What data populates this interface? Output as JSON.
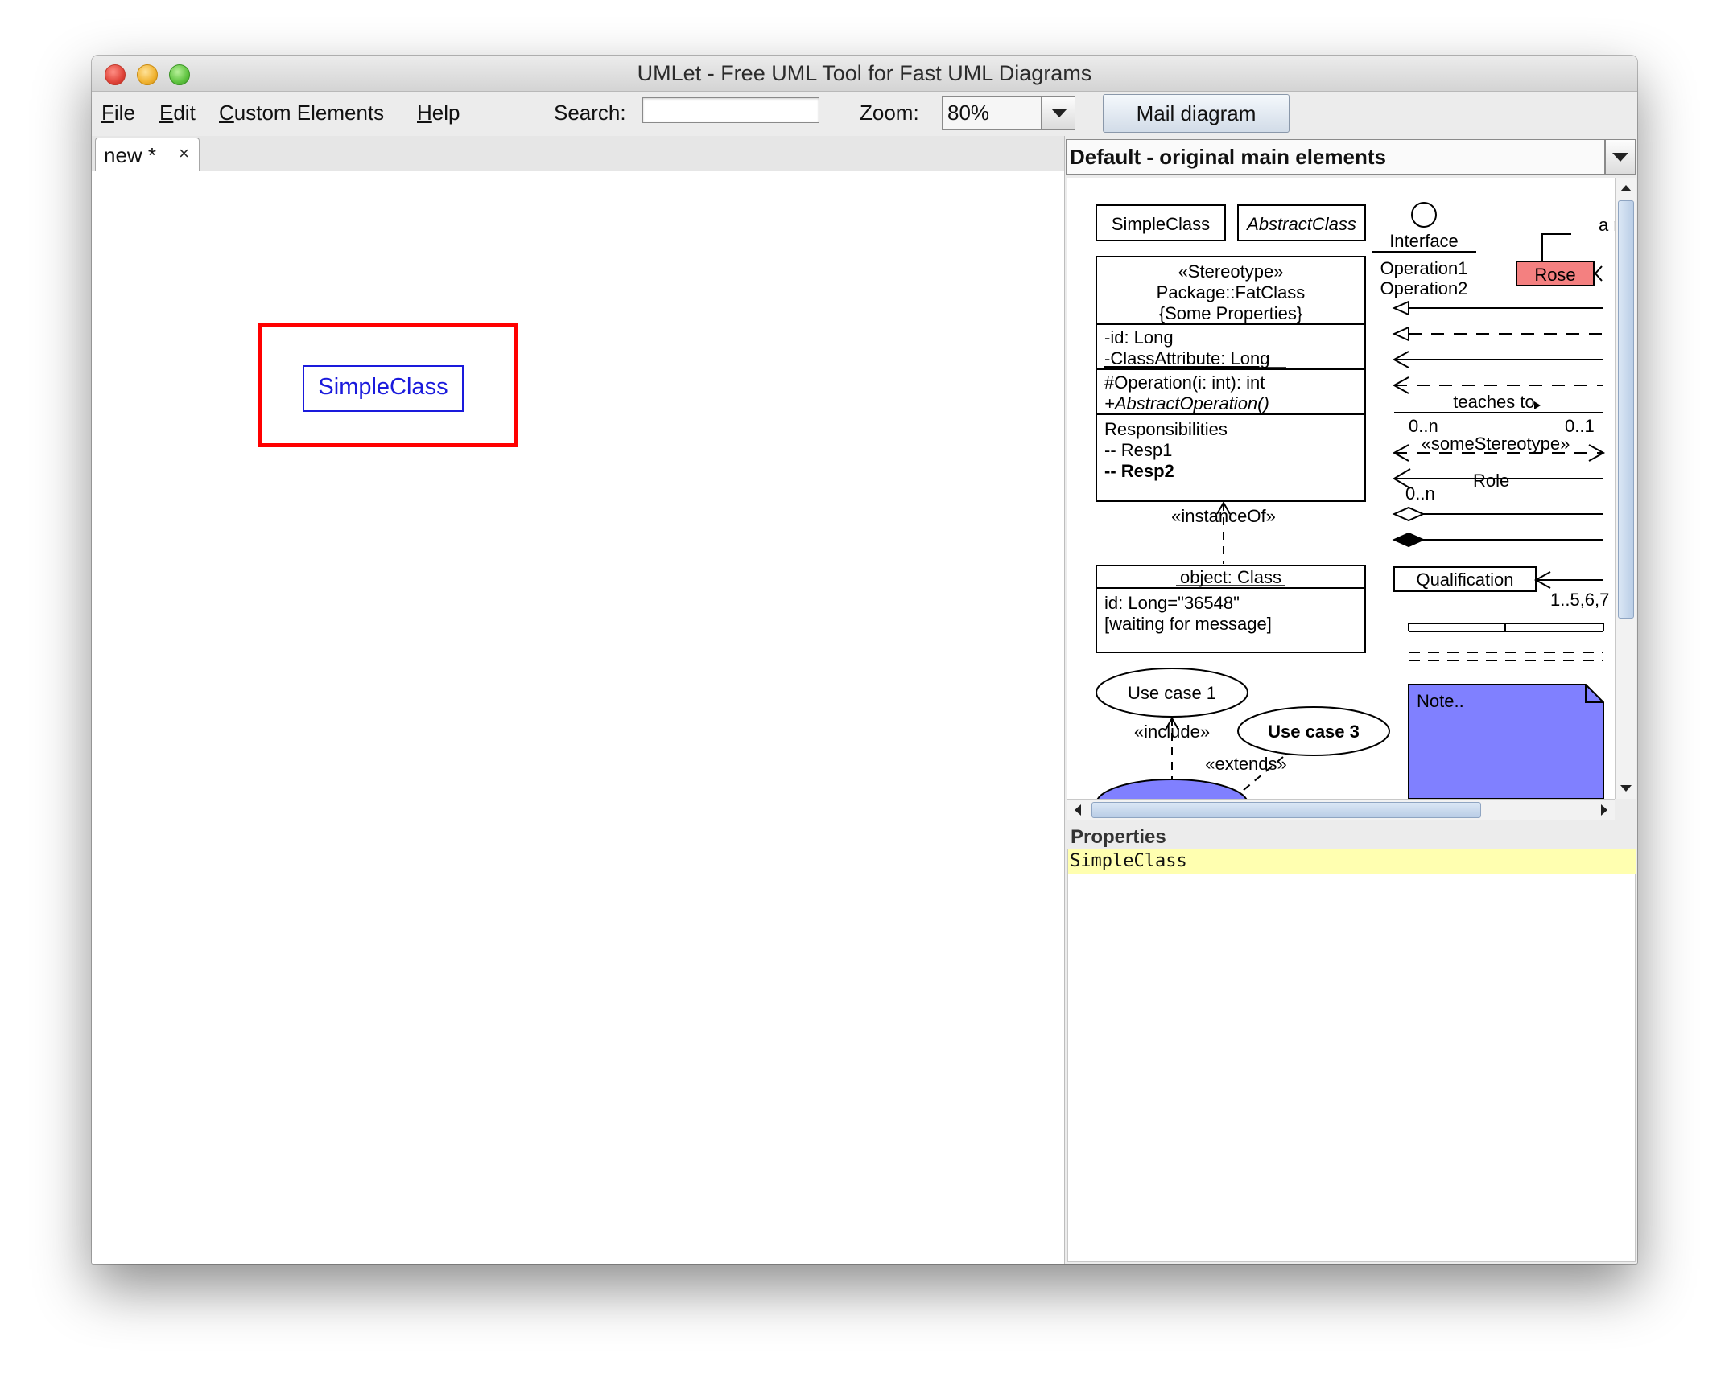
{
  "window": {
    "title": "UMLet - Free UML Tool for Fast UML Diagrams"
  },
  "menu": {
    "items": [
      {
        "mnemonic": "F",
        "rest": "ile"
      },
      {
        "mnemonic": "E",
        "rest": "dit"
      },
      {
        "mnemonic": "C",
        "rest": "ustom Elements"
      },
      {
        "mnemonic": "H",
        "rest": "elp"
      }
    ],
    "search_label": "Search:",
    "search_value": "",
    "zoom_label": "Zoom:",
    "zoom_value": "80%",
    "mail_button": "Mail diagram"
  },
  "editor": {
    "tab_label": "new *",
    "tab_close": "×",
    "element_label": "SimpleClass"
  },
  "palette": {
    "selected": "Default - original main elements",
    "simple_class": "SimpleClass",
    "abstract_class": "AbstractClass",
    "interface_name": "Interface",
    "interface_op1": "Operation1",
    "interface_op2": "Operation2",
    "rose_label": "Rose",
    "rose_edge_label": "a r",
    "fat_stereotype": "«Stereotype»",
    "fat_name": "Package::FatClass",
    "fat_props": "{Some Properties}",
    "fat_attr1": "-id: Long",
    "fat_attr2": "-ClassAttribute: Long",
    "fat_op1": "#Operation(i: int): int",
    "fat_op2": "+AbstractOperation()",
    "fat_resp_title": "Responsibilities",
    "fat_resp1": "-- Resp1",
    "fat_resp2": "-- Resp2",
    "instanceof_label": "«instanceOf»",
    "object_name": "object: Class",
    "object_attr": "id: Long=\"36548\"",
    "object_state": "[waiting for message]",
    "usecase1": "Use case 1",
    "usecase3": "Use case 3",
    "include_label": "«include»",
    "extends_label": "«extends»",
    "teaches_label": "teaches to",
    "mult_left": "0..n",
    "mult_right": "0..1",
    "stereo_label": "«someStereotype»",
    "role_mult": "0..n",
    "role_label": "Role",
    "qualification": "Qualification",
    "qual_mult": "1..5,6,7",
    "note_label": "Note.."
  },
  "properties": {
    "label": "Properties",
    "text": "SimpleClass"
  },
  "colors": {
    "selection": "#ff0000",
    "selected_element": "#1a1adc",
    "rose": "#f48080",
    "note": "#8080ff",
    "properties_bg": "#ffffb0"
  }
}
